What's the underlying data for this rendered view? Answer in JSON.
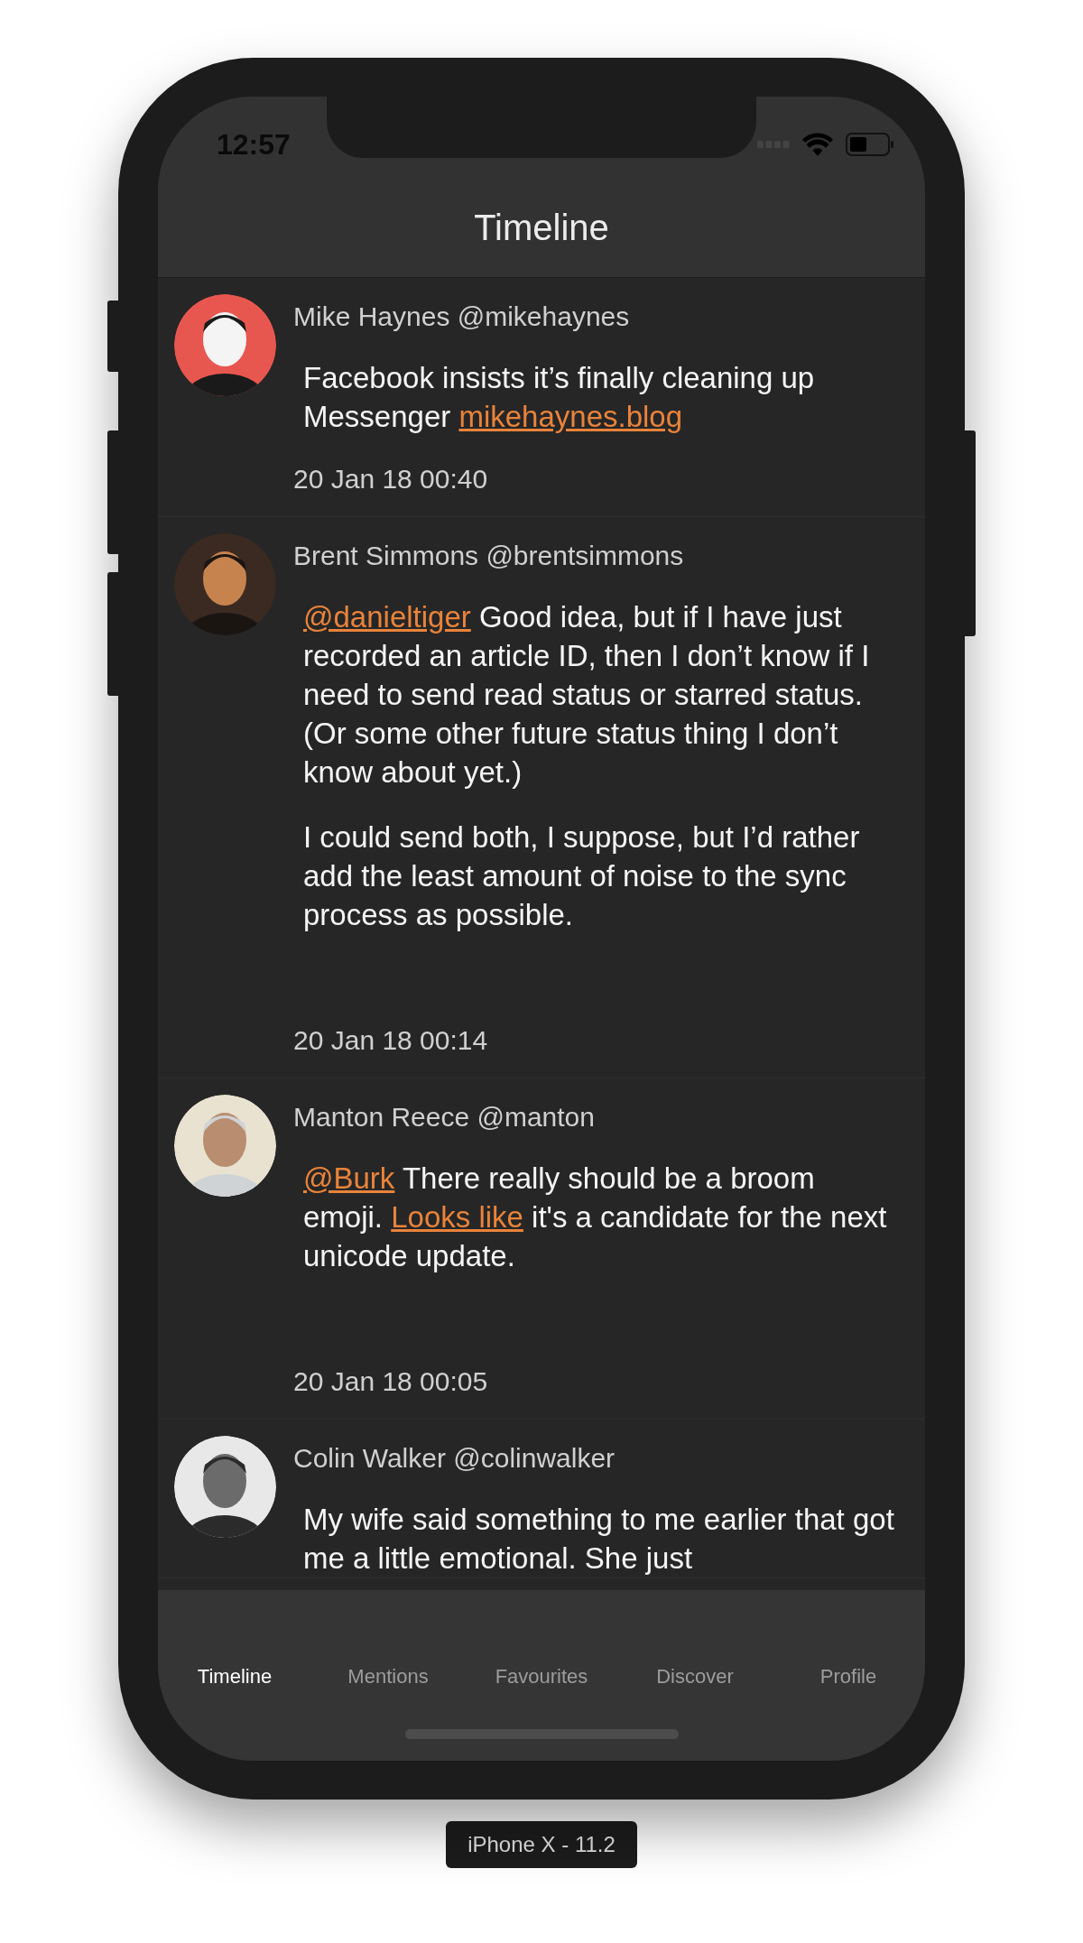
{
  "status_bar": {
    "time": "12:57"
  },
  "nav_bar": {
    "title": "Timeline"
  },
  "posts": [
    {
      "author": "Mike Haynes @mikehaynes",
      "paragraphs": [
        [
          {
            "text": "Facebook insists it’s finally cleaning up Messenger ",
            "link": false
          },
          {
            "text": "mikehaynes.blog",
            "link": true
          }
        ]
      ],
      "date": "20 Jan 18 00:40"
    },
    {
      "author": "Brent Simmons @brentsimmons",
      "paragraphs": [
        [
          {
            "text": "@danieltiger",
            "link": true
          },
          {
            "text": " Good idea, but if I have just recorded an article ID, then I don’t know if I need to send read status or starred status. (Or some other future status thing I don’t know about yet.)",
            "link": false
          }
        ],
        [
          {
            "text": "I could send both, I suppose, but I’d rather add the least amount of noise to the sync process as possible.",
            "link": false
          }
        ]
      ],
      "date": "20 Jan 18 00:14"
    },
    {
      "author": "Manton Reece @manton",
      "paragraphs": [
        [
          {
            "text": "@Burk",
            "link": true
          },
          {
            "text": " There really should be a broom emoji. ",
            "link": false
          },
          {
            "text": "Looks like",
            "link": true
          },
          {
            "text": " it's a candidate for the next unicode update.",
            "link": false
          }
        ]
      ],
      "date": "20 Jan 18 00:05"
    },
    {
      "author": "Colin Walker @colinwalker",
      "paragraphs": [
        [
          {
            "text": "My wife said something to me earlier that got me a little emotional. She just",
            "link": false
          }
        ]
      ]
    }
  ],
  "tabs": [
    {
      "label": "Timeline",
      "selected": true
    },
    {
      "label": "Mentions",
      "selected": false
    },
    {
      "label": "Favourites",
      "selected": false
    },
    {
      "label": "Discover",
      "selected": false
    },
    {
      "label": "Profile",
      "selected": false
    }
  ],
  "device_label": "iPhone X - 11.2"
}
